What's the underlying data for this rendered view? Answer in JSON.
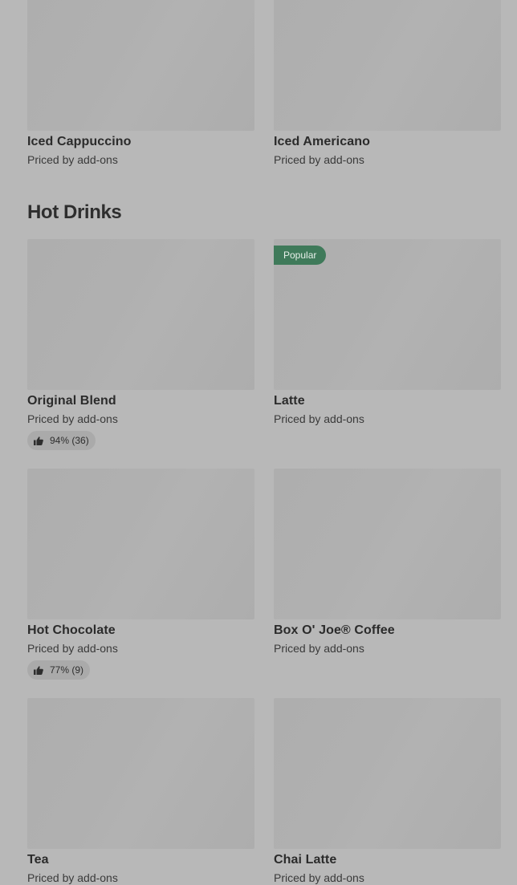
{
  "top_items": [
    {
      "name": "Iced Cappuccino",
      "price": "Priced by add-ons"
    },
    {
      "name": "Iced Americano",
      "price": "Priced by add-ons"
    }
  ],
  "section": {
    "title": "Hot Drinks"
  },
  "hot_drinks": [
    {
      "name": "Original Blend",
      "price": "Priced by add-ons",
      "rating": "94% (36)"
    },
    {
      "name": "Latte",
      "price": "Priced by add-ons",
      "badge": "Popular"
    },
    {
      "name": "Hot Chocolate",
      "price": "Priced by add-ons",
      "rating": "77% (9)"
    },
    {
      "name": "Box O' Joe® Coffee",
      "price": "Priced by add-ons"
    },
    {
      "name": "Tea",
      "price": "Priced by add-ons"
    },
    {
      "name": "Chai Latte",
      "price": "Priced by add-ons"
    }
  ],
  "icons": {
    "rating_icon": "thumbs-up-icon"
  },
  "colors": {
    "background": "#b8b8b8",
    "badge": "#3f7a5a"
  }
}
